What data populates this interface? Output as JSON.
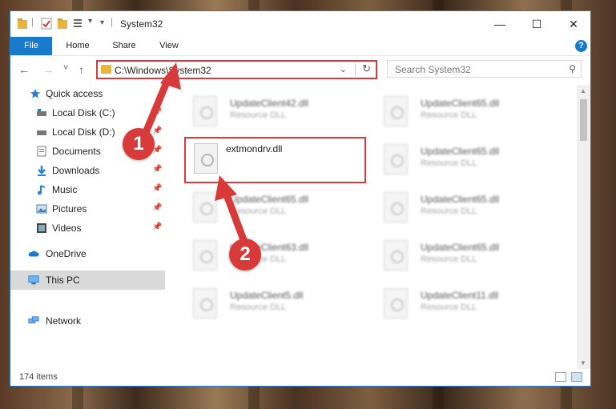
{
  "window": {
    "title": "System32",
    "controls": {
      "minimize": "—",
      "maximize": "☐",
      "close": "✕"
    }
  },
  "ribbon": {
    "tabs": [
      "File",
      "Home",
      "Share",
      "View"
    ],
    "help": "?"
  },
  "navigation": {
    "back": "←",
    "forward": "→",
    "recent": "˅",
    "up": "↑",
    "address": "C:\\Windows\\System32",
    "search_placeholder": "Search System32"
  },
  "sidebar": {
    "items": [
      {
        "label": "Quick access",
        "icon": "star-icon",
        "pinned": false
      },
      {
        "label": "Local Disk (C:)",
        "icon": "drive-icon",
        "pinned": true
      },
      {
        "label": "Local Disk (D:)",
        "icon": "drive-icon",
        "pinned": true
      },
      {
        "label": "Documents",
        "icon": "document-icon",
        "pinned": true
      },
      {
        "label": "Downloads",
        "icon": "download-icon",
        "pinned": true
      },
      {
        "label": "Music",
        "icon": "music-icon",
        "pinned": true
      },
      {
        "label": "Pictures",
        "icon": "pictures-icon",
        "pinned": true
      },
      {
        "label": "Videos",
        "icon": "video-icon",
        "pinned": true
      },
      {
        "label": "OneDrive",
        "icon": "cloud-icon",
        "pinned": false
      },
      {
        "label": "This PC",
        "icon": "computer-icon",
        "pinned": false,
        "selected": true
      },
      {
        "label": "Network",
        "icon": "network-icon",
        "pinned": false
      }
    ]
  },
  "files": {
    "highlighted": {
      "name": "extmondrv.dll"
    },
    "items": [
      {
        "name": "UpdateClient42.dll",
        "type": "Resource DLL"
      },
      {
        "name": "UpdateClient65.dll",
        "type": "Resource DLL"
      },
      {
        "name": "UpdateClient65.dll",
        "type": "Resource DLL"
      },
      {
        "name": "UpdateClient65.dll",
        "type": "Resource DLL"
      },
      {
        "name": "UpdateClient65.dll",
        "type": "Resource DLL"
      },
      {
        "name": "UpdateClient63.dll",
        "type": "Resource DLL"
      },
      {
        "name": "UpdateClient65.dll",
        "type": "Resource DLL"
      },
      {
        "name": "UpdateClient5.dll",
        "type": "Resource DLL"
      },
      {
        "name": "UpdateClient11.dll",
        "type": "Resource DLL"
      }
    ]
  },
  "status": {
    "count": "174 items"
  },
  "callouts": {
    "step1": "1",
    "step2": "2"
  },
  "colors": {
    "accent": "#1979ca",
    "callout": "#d83a3a",
    "folder": "#e8b43c"
  }
}
